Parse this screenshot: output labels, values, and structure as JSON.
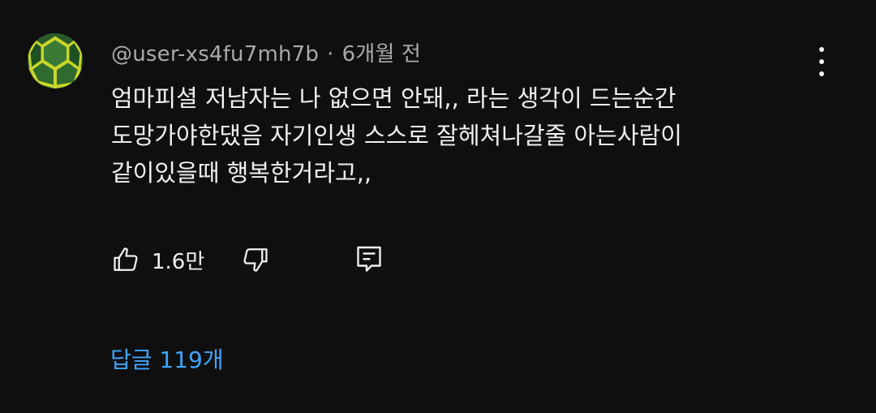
{
  "comment": {
    "username": "@user-xs4fu7mh7b",
    "separator": "·",
    "time": "6개월 전",
    "text": "엄마피셜 저남자는 나 없으면 안돼,, 라는 생각이 드는순간\n도망가야한댔음 자기인생 스스로 잘헤쳐나갈줄 아는사람이\n같이있을때 행복한거라고,,",
    "avatar_icon": "turtle-shell-avatar",
    "like_count": "1.6만",
    "replies_label": "답글 119개",
    "colors": {
      "background": "#0f0f0f",
      "text": "#f1f1f1",
      "meta": "#aaaaaa",
      "link": "#3ea6ff"
    }
  }
}
